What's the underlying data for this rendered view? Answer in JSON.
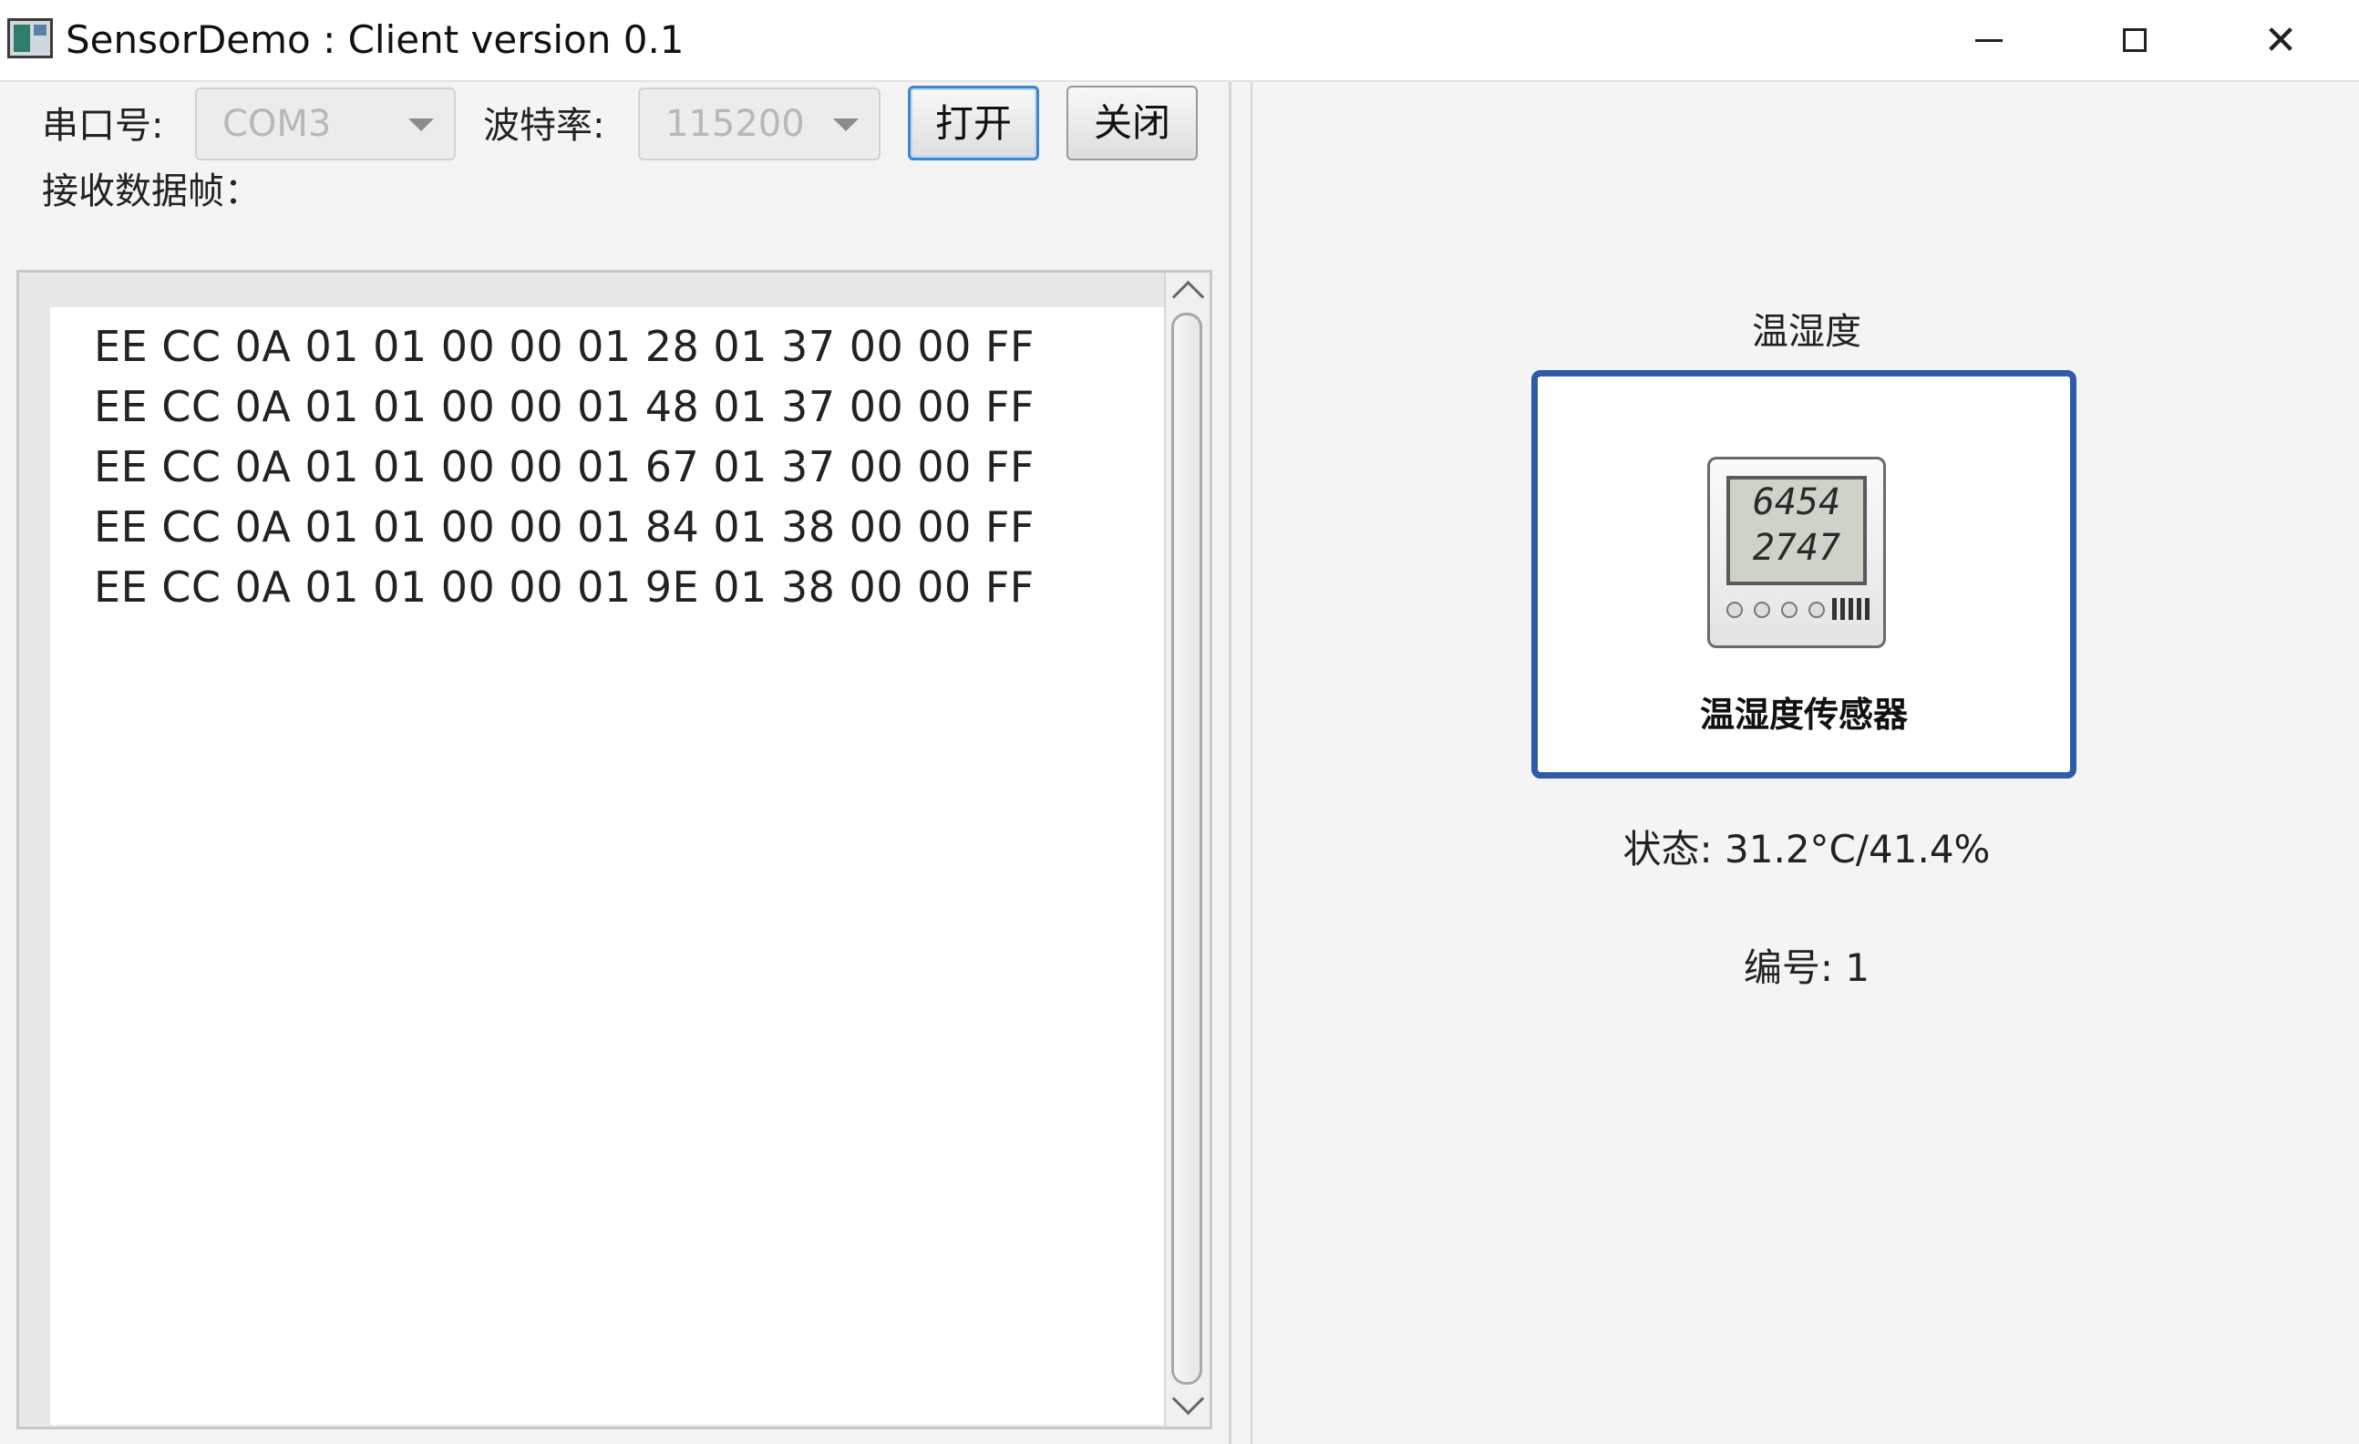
{
  "window": {
    "title": "SensorDemo : Client version 0.1",
    "controls": {
      "minimize": "—",
      "maximize": "□",
      "close": "✕"
    }
  },
  "serial": {
    "port_label": "串口号:",
    "port_value": "COM3",
    "baud_label": "波特率:",
    "baud_value": "115200",
    "open_label": "打开",
    "close_label": "关闭",
    "receive_label": "接收数据帧："
  },
  "frames": [
    "EE CC 0A 01 01 00 00 01 28 01 37 00 00 FF",
    "EE CC 0A 01 01 00 00 01 48 01 37 00 00 FF",
    "EE CC 0A 01 01 00 00 01 67 01 37 00 00 FF",
    "EE CC 0A 01 01 00 00 01 84 01 38 00 00 FF",
    "EE CC 0A 01 01 00 00 01 9E 01 38 00 00 FF"
  ],
  "sensor": {
    "heading": "温湿度",
    "card_label": "温湿度传感器",
    "lcd_top": "6454",
    "lcd_bottom": "2747",
    "status": "状态: 31.2°C/41.4%",
    "id": "编号: 1",
    "accent_color": "#2f5aa7"
  }
}
